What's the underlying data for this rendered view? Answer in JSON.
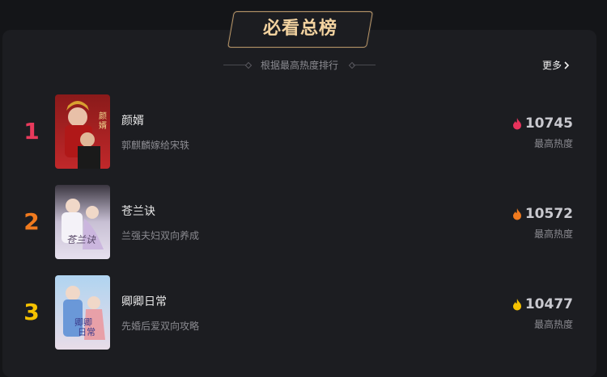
{
  "header": {
    "title": "必看总榜",
    "subtitle": "根据最高热度排行",
    "more_label": "更多"
  },
  "rankings": [
    {
      "rank": "1",
      "name": "颜婿",
      "desc": "郭麒麟嫁给宋轶",
      "heat": "10745",
      "heat_label": "最高热度",
      "rank_color": "#e83a5c",
      "flame_color": "#e8335c"
    },
    {
      "rank": "2",
      "name": "苍兰诀",
      "desc": "兰强夫妇双向养成",
      "heat": "10572",
      "heat_label": "最高热度",
      "rank_color": "#f07a1e",
      "flame_color": "#f07a1e"
    },
    {
      "rank": "3",
      "name": "卿卿日常",
      "desc": "先婚后爱双向攻略",
      "heat": "10477",
      "heat_label": "最高热度",
      "rank_color": "#f5c100",
      "flame_color": "#f5c100"
    }
  ]
}
